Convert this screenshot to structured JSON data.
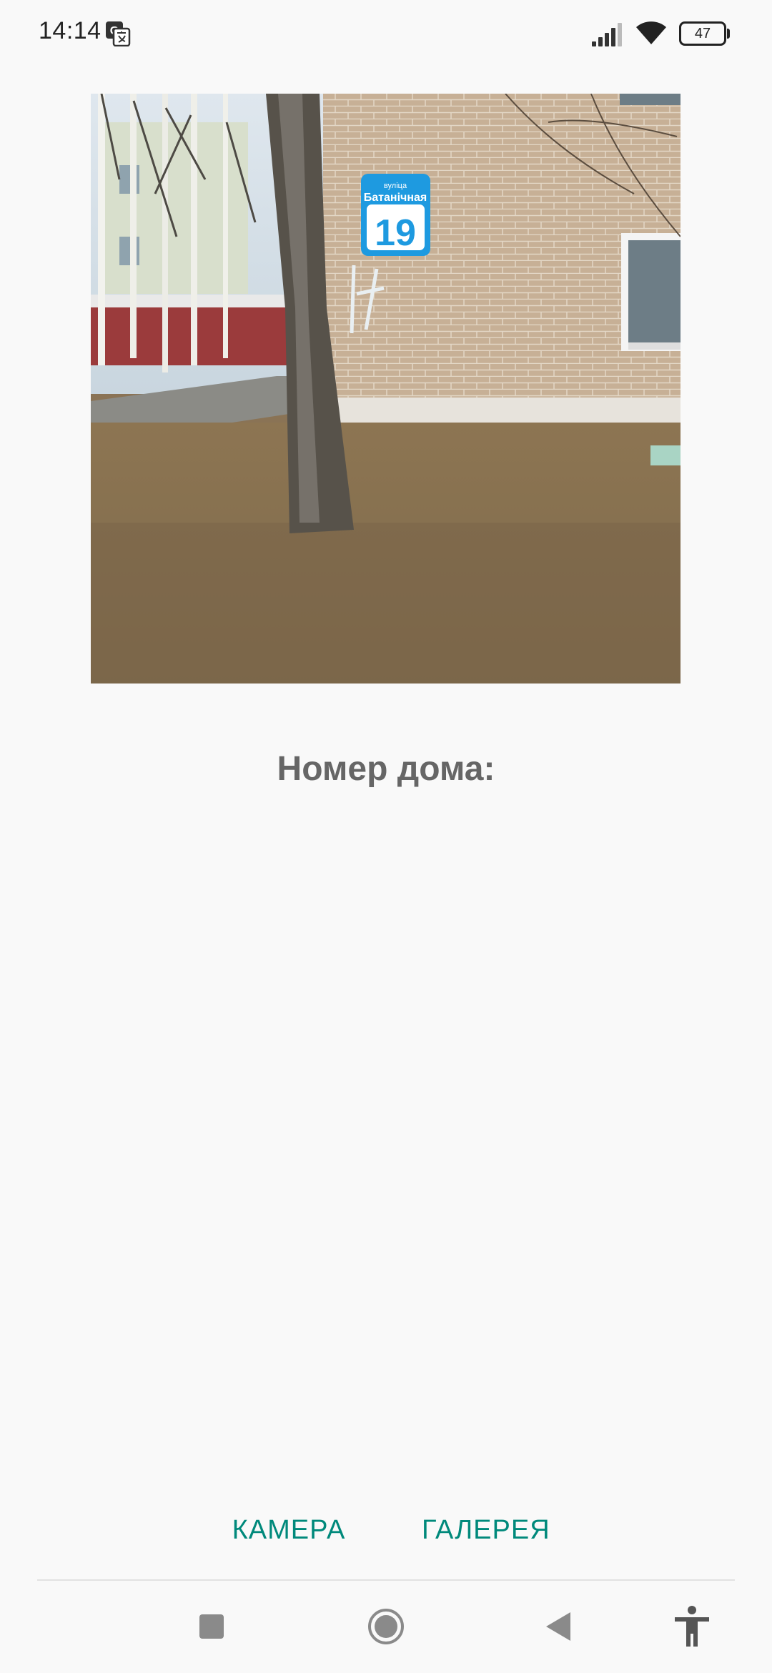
{
  "status_bar": {
    "time": "14:14",
    "battery_level": "47",
    "icons": [
      "translate-icon",
      "signal-icon",
      "wifi-icon",
      "battery-icon"
    ]
  },
  "photo": {
    "sign_street_label": "вуліца",
    "sign_street_name": "Батанічная",
    "sign_house_number": "19"
  },
  "result": {
    "label": "Номер дома:"
  },
  "actions": {
    "camera_label": "КАМЕРА",
    "gallery_label": "ГАЛЕРЕЯ"
  },
  "nav_bar": {
    "icons": [
      "recents-icon",
      "home-icon",
      "back-icon",
      "accessibility-icon"
    ]
  },
  "colors": {
    "accent": "#00897b",
    "label_gray": "#666666",
    "background": "#f9f9f9",
    "sign_blue": "#1e9ae0"
  }
}
